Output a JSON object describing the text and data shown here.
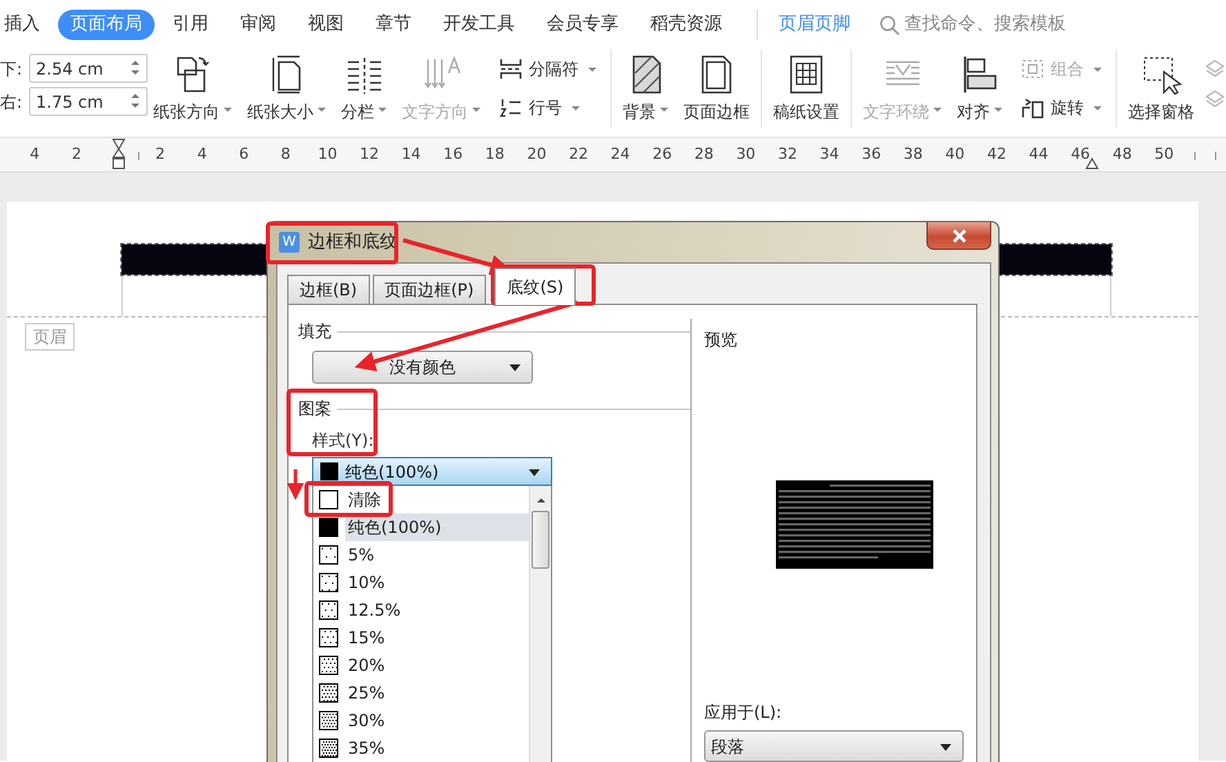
{
  "menu_tabs": [
    {
      "label": "插入",
      "selected": false
    },
    {
      "label": "页面布局",
      "selected": true
    },
    {
      "label": "引用",
      "selected": false
    },
    {
      "label": "审阅",
      "selected": false
    },
    {
      "label": "视图",
      "selected": false
    },
    {
      "label": "章节",
      "selected": false
    },
    {
      "label": "开发工具",
      "selected": false
    },
    {
      "label": "会员专享",
      "selected": false
    },
    {
      "label": "稻壳资源",
      "selected": false
    }
  ],
  "context_tab": {
    "label": "页眉页脚"
  },
  "search": {
    "placeholder": "查找命令、搜索模板"
  },
  "margins": [
    {
      "label": "下:",
      "value": "2.54 cm"
    },
    {
      "label": "右:",
      "value": "1.75 cm"
    }
  ],
  "ribbon_groups": [
    [
      {
        "kind": "large",
        "label": "纸张方向",
        "dropdown": true,
        "disabled": false
      },
      {
        "kind": "large",
        "label": "纸张大小",
        "dropdown": true,
        "disabled": false
      },
      {
        "kind": "large",
        "label": "分栏",
        "dropdown": true,
        "disabled": false
      },
      {
        "kind": "large",
        "label": "文字方向",
        "dropdown": true,
        "disabled": true
      },
      {
        "kind": "stack",
        "items": [
          {
            "label": "分隔符",
            "dropdown": true,
            "disabled": false
          },
          {
            "label": "行号",
            "dropdown": true,
            "disabled": false
          }
        ]
      }
    ],
    [
      {
        "kind": "large",
        "label": "背景",
        "dropdown": true,
        "disabled": false
      },
      {
        "kind": "large",
        "label": "页面边框",
        "dropdown": false,
        "disabled": false
      }
    ],
    [
      {
        "kind": "large",
        "label": "稿纸设置",
        "dropdown": false,
        "disabled": false
      }
    ],
    [
      {
        "kind": "large",
        "label": "文字环绕",
        "dropdown": true,
        "disabled": true
      },
      {
        "kind": "large",
        "label": "对齐",
        "dropdown": true,
        "disabled": false
      },
      {
        "kind": "stack",
        "items": [
          {
            "label": "组合",
            "dropdown": true,
            "disabled": true
          },
          {
            "label": "旋转",
            "dropdown": true,
            "disabled": false
          }
        ]
      }
    ],
    [
      {
        "kind": "large",
        "label": "选择窗格",
        "dropdown": false,
        "disabled": false
      }
    ]
  ],
  "ruler": {
    "labels": [
      "4",
      "2",
      "2",
      "4",
      "6",
      "8",
      "10",
      "12",
      "14",
      "16",
      "18",
      "20",
      "22",
      "24",
      "26",
      "28",
      "30",
      "32",
      "34",
      "36",
      "38",
      "40",
      "42",
      "44",
      "46",
      "48",
      "50"
    ]
  },
  "page": {
    "header_label": "页眉"
  },
  "dialog": {
    "icon_text": "W",
    "title": "边框和底纹",
    "tabs": [
      {
        "label": "边框(B)",
        "selected": false
      },
      {
        "label": "页面边框(P)",
        "selected": false
      },
      {
        "label": "底纹(S)",
        "selected": true
      }
    ],
    "fill": {
      "legend": "填充",
      "value": "没有颜色"
    },
    "pattern": {
      "legend": "图案",
      "style_label": "样式(Y):",
      "style_value": "纯色(100%)",
      "options": [
        {
          "label": "清除",
          "selected": false
        },
        {
          "label": "纯色(100%)",
          "selected": true
        },
        {
          "label": "5%",
          "selected": false
        },
        {
          "label": "10%",
          "selected": false
        },
        {
          "label": "12.5%",
          "selected": false
        },
        {
          "label": "15%",
          "selected": false
        },
        {
          "label": "20%",
          "selected": false
        },
        {
          "label": "25%",
          "selected": false
        },
        {
          "label": "30%",
          "selected": false
        },
        {
          "label": "35%",
          "selected": false
        }
      ]
    },
    "preview": {
      "legend": "预览"
    },
    "apply_to": {
      "label": "应用于(L):",
      "value": "段落"
    }
  }
}
